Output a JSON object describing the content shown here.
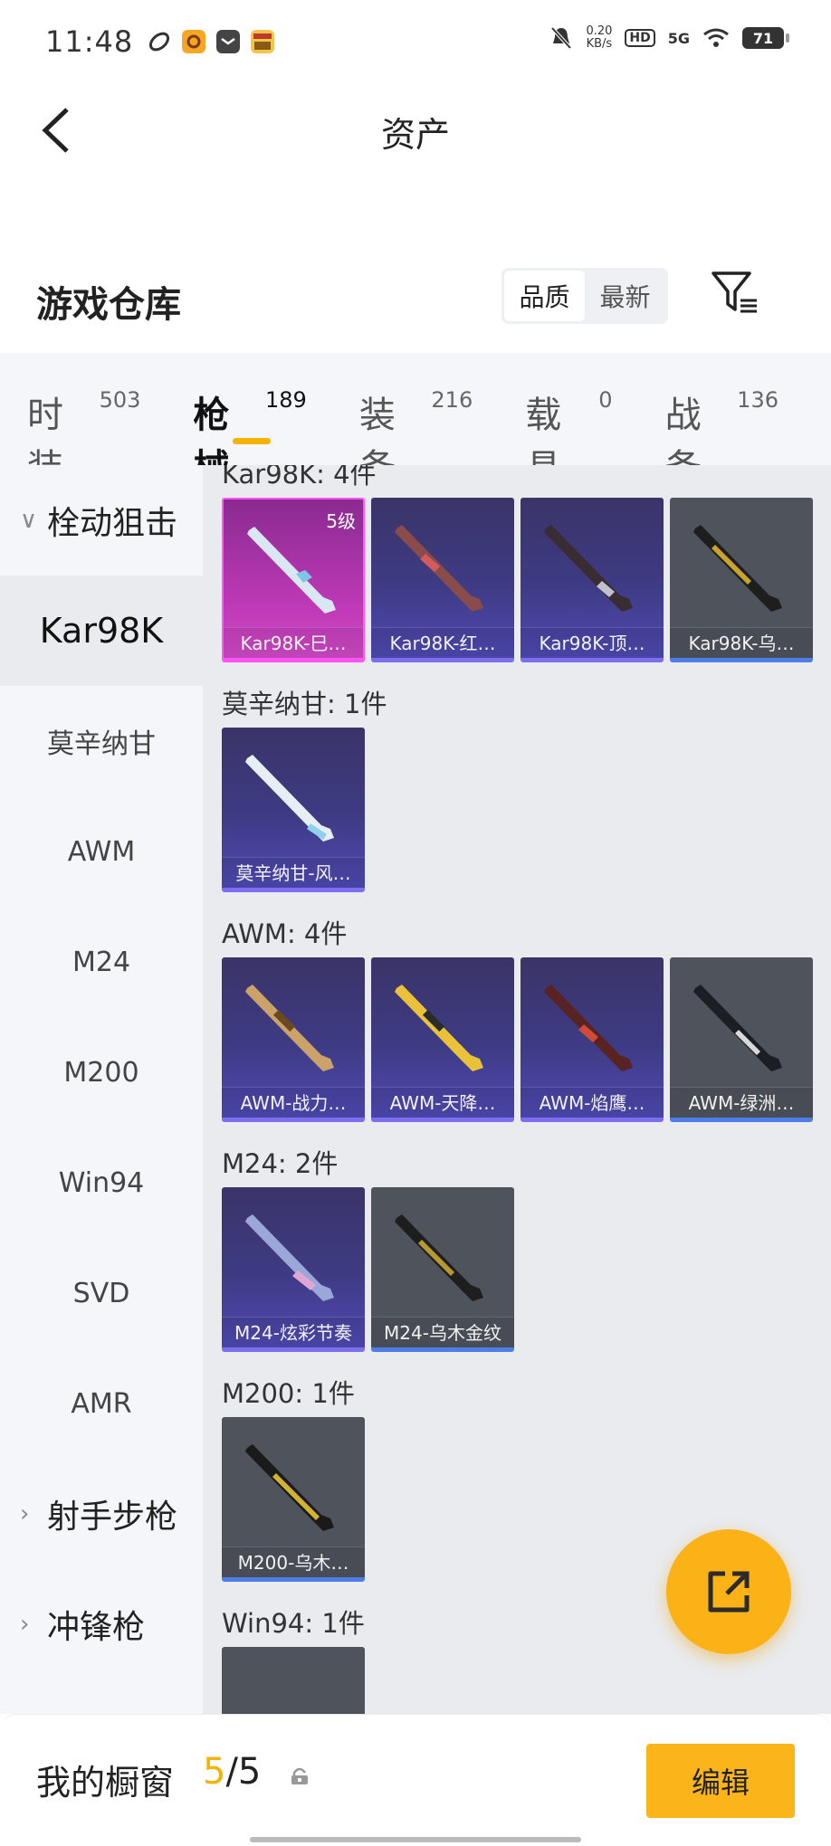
{
  "status_bar": {
    "time": "11:48",
    "speed": "0.20",
    "speed_unit": "KB/s",
    "hd": "HD",
    "network": "5G",
    "battery": "71"
  },
  "nav": {
    "title": "资产"
  },
  "warehouse": {
    "title": "游戏仓库",
    "sort_options": [
      "品质",
      "最新"
    ],
    "active_sort": "品质"
  },
  "tabs": [
    {
      "label": "时装",
      "count": "503"
    },
    {
      "label": "枪械",
      "count": "189"
    },
    {
      "label": "装备",
      "count": "216"
    },
    {
      "label": "载具",
      "count": "0"
    },
    {
      "label": "战备",
      "count": "136"
    }
  ],
  "active_tab": "枪械",
  "sidebar": {
    "items": [
      {
        "label": "栓动狙击",
        "type": "group",
        "expanded": true
      },
      {
        "label": "Kar98K",
        "type": "sub",
        "selected": true
      },
      {
        "label": "莫辛纳甘",
        "type": "sub"
      },
      {
        "label": "AWM",
        "type": "sub"
      },
      {
        "label": "M24",
        "type": "sub"
      },
      {
        "label": "M200",
        "type": "sub"
      },
      {
        "label": "Win94",
        "type": "sub"
      },
      {
        "label": "SVD",
        "type": "sub"
      },
      {
        "label": "AMR",
        "type": "sub"
      },
      {
        "label": "射手步枪",
        "type": "group",
        "expanded": false
      },
      {
        "label": "冲锋枪",
        "type": "group",
        "expanded": false
      }
    ]
  },
  "groups": [
    {
      "title": "Kar98K: 4件",
      "items": [
        {
          "name": "Kar98K-巳…",
          "rarity": "pink",
          "level": "5级"
        },
        {
          "name": "Kar98K-红…",
          "rarity": "purple"
        },
        {
          "name": "Kar98K-顶…",
          "rarity": "purple"
        },
        {
          "name": "Kar98K-乌…",
          "rarity": "grey"
        }
      ]
    },
    {
      "title": "莫辛纳甘: 1件",
      "items": [
        {
          "name": "莫辛纳甘-风…",
          "rarity": "purple"
        }
      ]
    },
    {
      "title": "AWM: 4件",
      "items": [
        {
          "name": "AWM-战力…",
          "rarity": "purple"
        },
        {
          "name": "AWM-天降…",
          "rarity": "purple"
        },
        {
          "name": "AWM-焰鹰…",
          "rarity": "purple"
        },
        {
          "name": "AWM-绿洲…",
          "rarity": "grey"
        }
      ]
    },
    {
      "title": "M24: 2件",
      "items": [
        {
          "name": "M24-炫彩节奏",
          "rarity": "purple"
        },
        {
          "name": "M24-乌木金纹",
          "rarity": "grey"
        }
      ]
    },
    {
      "title": "M200: 1件",
      "items": [
        {
          "name": "M200-乌木…",
          "rarity": "grey"
        }
      ]
    },
    {
      "title": "Win94: 1件",
      "items": [
        {
          "name": "",
          "rarity": "grey"
        }
      ]
    }
  ],
  "bottom": {
    "label": "我的橱窗",
    "count_current": "5",
    "count_total": "/5",
    "edit_label": "编辑"
  },
  "colors": {
    "accent": "#fbb216",
    "purple_rarity": "#7d6ef0",
    "pink_rarity": "#ff53f5",
    "grey_rarity": "#4c7de8"
  }
}
